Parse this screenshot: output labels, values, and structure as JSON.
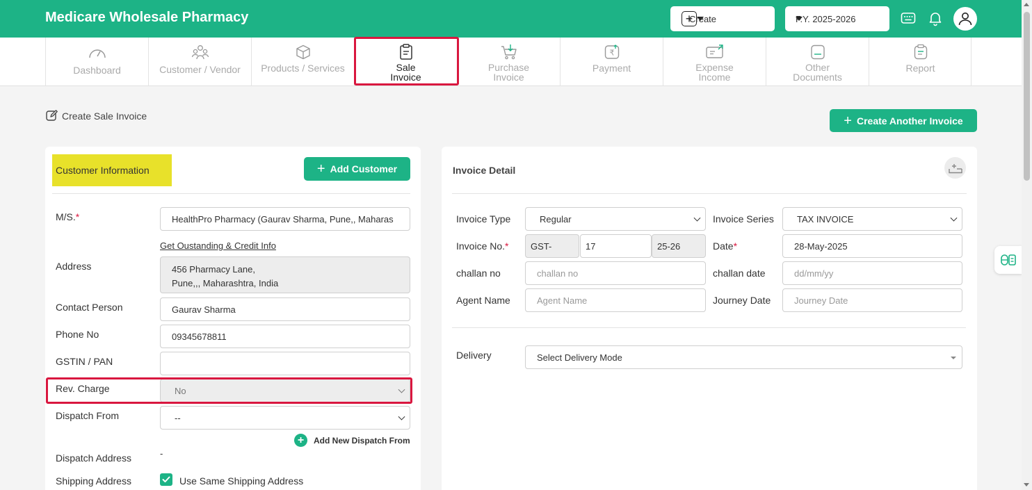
{
  "app": {
    "title": "Medicare Wholesale Pharmacy"
  },
  "topbar": {
    "create_label": "Create",
    "fiscal_year": "F.Y. 2025-2026",
    "icons": [
      "plus-square-icon",
      "caret-down-icon",
      "keyboard-icon",
      "bell-icon",
      "user-avatar-icon"
    ]
  },
  "nav": {
    "items": [
      {
        "label": "Dashboard",
        "icon": "gauge-icon"
      },
      {
        "label": "Customer / Vendor",
        "icon": "users-icon"
      },
      {
        "label": "Products / Services",
        "icon": "box-icon"
      },
      {
        "label": "Sale Invoice",
        "icon": "clipboard-icon",
        "active": true
      },
      {
        "label": "Purchase Invoice",
        "icon": "cart-icon"
      },
      {
        "label": "Payment",
        "icon": "rupee-icon"
      },
      {
        "label": "Expense Income",
        "icon": "cash-icon"
      },
      {
        "label": "Other Documents",
        "icon": "document-icon"
      },
      {
        "label": "Report",
        "icon": "report-icon"
      }
    ]
  },
  "page": {
    "title": "Create Sale Invoice",
    "create_another_label": "Create Another Invoice"
  },
  "customer": {
    "section_title": "Customer Information",
    "add_customer_label": "Add Customer",
    "ms_label": "M/S.",
    "ms_value": "HealthPro Pharmacy (Gaurav Sharma, Pune,, Maharas",
    "outstanding_link": "Get Oustanding & Credit Info",
    "address_label": "Address",
    "address_line1": "456 Pharmacy Lane,",
    "address_line2": "Pune,,, Maharashtra, India",
    "contact_label": "Contact Person",
    "contact_value": "Gaurav Sharma",
    "phone_label": "Phone No",
    "phone_value": "09345678811",
    "gstin_label": "GSTIN / PAN",
    "gstin_value": "",
    "rev_charge_label": "Rev. Charge",
    "rev_charge_value": "No",
    "dispatch_from_label": "Dispatch From",
    "dispatch_from_value": "--",
    "add_dispatch_label": "Add New Dispatch From",
    "dispatch_address_label": "Dispatch Address",
    "dispatch_address_value": "-",
    "shipping_address_label": "Shipping Address",
    "same_shipping_label": "Use Same Shipping Address",
    "same_shipping_checked": true
  },
  "invoice": {
    "section_title": "Invoice Detail",
    "type_label": "Invoice Type",
    "type_value": "Regular",
    "series_label": "Invoice Series",
    "series_value": "TAX INVOICE",
    "no_label": "Invoice No.",
    "no_prefix": "GST-",
    "no_value": "17",
    "no_suffix": "25-26",
    "date_label": "Date",
    "date_value": "28-May-2025",
    "challan_no_label": "challan no",
    "challan_no_placeholder": "challan no",
    "challan_date_label": "challan date",
    "challan_date_placeholder": "dd/mm/yy",
    "agent_label": "Agent Name",
    "agent_placeholder": "Agent Name",
    "journey_label": "Journey Date",
    "journey_placeholder": "Journey Date",
    "delivery_label": "Delivery",
    "delivery_value": "Select Delivery Mode"
  },
  "colors": {
    "brand": "#1db386",
    "highlight": "#e8e12a",
    "annotation": "#d9173f"
  }
}
